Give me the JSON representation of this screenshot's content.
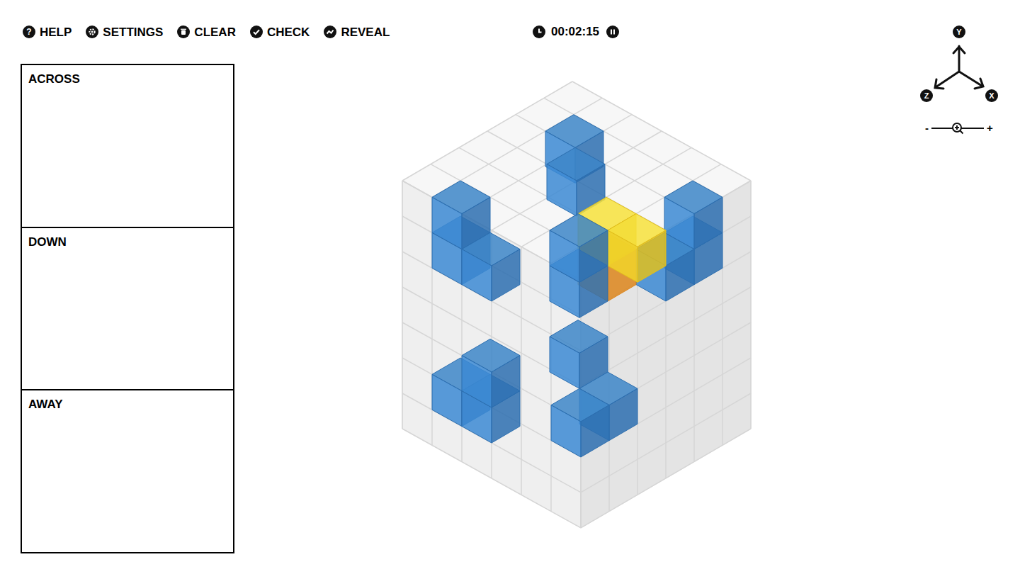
{
  "toolbar": [
    {
      "label": "HELP",
      "glyph": "?"
    },
    {
      "label": "SETTINGS"
    },
    {
      "label": "CLEAR"
    },
    {
      "label": "CHECK"
    },
    {
      "label": "REVEAL"
    }
  ],
  "timer": {
    "time": "00:02:15",
    "paused": false
  },
  "panels": [
    {
      "title": "ACROSS"
    },
    {
      "title": "DOWN"
    },
    {
      "title": "AWAY"
    }
  ],
  "axes": [
    {
      "label": "Y"
    },
    {
      "label": "Z"
    },
    {
      "label": "X"
    }
  ],
  "zoom": {
    "minus": "-",
    "plus": "+",
    "level": 0.5
  },
  "cube": {
    "size": [
      6,
      7,
      6
    ],
    "cells": [
      {
        "x": 1,
        "y": 6,
        "z": 1,
        "state": "filled"
      },
      {
        "x": 2,
        "y": 6,
        "z": 2,
        "state": "filled"
      },
      {
        "x": 5,
        "y": 6,
        "z": 1,
        "state": "filled"
      },
      {
        "x": 5,
        "y": 5,
        "z": 1,
        "state": "filled"
      },
      {
        "x": 5,
        "y": 5,
        "z": 2,
        "state": "filled"
      },
      {
        "x": 4,
        "y": 6,
        "z": 3,
        "state": "selected"
      },
      {
        "x": 5,
        "y": 6,
        "z": 3,
        "state": "selected"
      },
      {
        "x": 4,
        "y": 5,
        "z": 3,
        "state": "cursor"
      },
      {
        "x": 4,
        "y": 6,
        "z": 4,
        "state": "filled"
      },
      {
        "x": 4,
        "y": 5,
        "z": 4,
        "state": "filled"
      },
      {
        "x": 1,
        "y": 6,
        "z": 5,
        "state": "filled"
      },
      {
        "x": 1,
        "y": 5,
        "z": 5,
        "state": "filled"
      },
      {
        "x": 2,
        "y": 5,
        "z": 5,
        "state": "filled"
      },
      {
        "x": 1,
        "y": 1,
        "z": 5,
        "state": "filled"
      },
      {
        "x": 2,
        "y": 1,
        "z": 5,
        "state": "filled"
      },
      {
        "x": 2,
        "y": 2,
        "z": 5,
        "state": "filled"
      },
      {
        "x": 4,
        "y": 3,
        "z": 4,
        "state": "filled"
      },
      {
        "x": 5,
        "y": 2,
        "z": 4,
        "state": "filled"
      },
      {
        "x": 5,
        "y": 2,
        "z": 5,
        "state": "filled"
      }
    ]
  }
}
